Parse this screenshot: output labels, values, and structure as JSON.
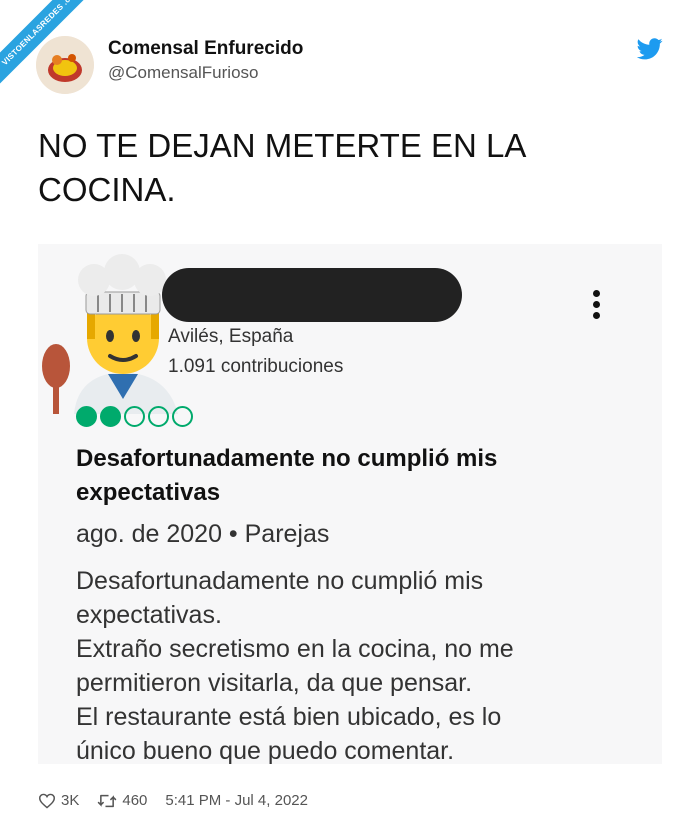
{
  "watermark": {
    "text": "VISTOENLASREDES .com"
  },
  "author": {
    "name": "Comensal Enfurecido",
    "handle": "@ComensalFurioso"
  },
  "tweet": {
    "text": "NO TE DEJAN METERTE EN LA\nCOCINA."
  },
  "review": {
    "location": "Avilés, España",
    "contributions": "1.091 contribuciones",
    "rating": {
      "filled": 2,
      "total": 5
    },
    "title": "Desafortunadamente no cumplió mis expectativas",
    "meta": "ago. de 2020 • Parejas",
    "body": "Desafortunadamente no cumplió mis\nexpectativas.\nExtraño secretismo en la cocina, no me\npermitieron visitarla, da que pensar.\nEl restaurante está bien ubicado, es lo\núnico bueno que puedo comentar."
  },
  "footer": {
    "likes": "3K",
    "retweets": "460",
    "timestamp": "5:41 PM - Jul 4, 2022"
  },
  "colors": {
    "twitter_blue": "#1d9bf0",
    "tripadvisor_green": "#00aa6c"
  }
}
